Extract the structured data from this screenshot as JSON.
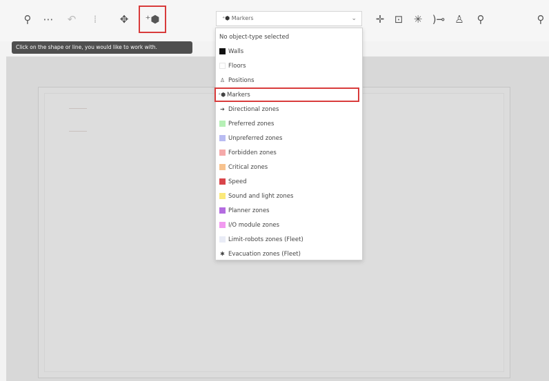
{
  "tooltip": "Click on the shape or line, you would like to work with.",
  "toolbar_left": [
    {
      "name": "search-icon",
      "glyph": "⚲",
      "dim": false
    },
    {
      "name": "ellipsis-icon",
      "glyph": "⋯",
      "dim": false
    },
    {
      "name": "undo-icon",
      "glyph": "↶",
      "dim": true
    },
    {
      "name": "divider-icon",
      "glyph": "⁞",
      "dim": true
    },
    {
      "name": "move-icon",
      "glyph": "✥",
      "dim": false
    },
    {
      "name": "add-marker-icon",
      "glyph": "⁺⬢",
      "dim": false
    }
  ],
  "toolbar_right": [
    {
      "name": "crosshair-icon",
      "glyph": "✛"
    },
    {
      "name": "zoom-fit-icon",
      "glyph": "⊡"
    },
    {
      "name": "sun-icon",
      "glyph": "✳"
    },
    {
      "name": "bracket-icon",
      "glyph": ")⊸"
    },
    {
      "name": "people-icon",
      "glyph": "♙"
    },
    {
      "name": "zoom-in-icon",
      "glyph": "⚲"
    },
    {
      "name": "zoom-out-icon",
      "glyph": "⚲"
    }
  ],
  "select": {
    "icon": "⁺⬢",
    "value": "Markers",
    "chevron": "⌄"
  },
  "options": [
    {
      "label": "No object-type selected",
      "kind": "none"
    },
    {
      "label": "Walls",
      "kind": "swatch",
      "color": "#111111"
    },
    {
      "label": "Floors",
      "kind": "swatch",
      "color": "#ffffff"
    },
    {
      "label": "Positions",
      "kind": "glyph",
      "glyph": "♙"
    },
    {
      "label": "Markers",
      "kind": "glyph",
      "glyph": "⁺⬢",
      "selected": true
    },
    {
      "label": "Directional zones",
      "kind": "glyph",
      "glyph": "➔"
    },
    {
      "label": "Preferred zones",
      "kind": "swatch",
      "color": "#b6f0b6"
    },
    {
      "label": "Unpreferred zones",
      "kind": "swatch",
      "color": "#b9bcf2"
    },
    {
      "label": "Forbidden zones",
      "kind": "swatch",
      "color": "#f5a9a9"
    },
    {
      "label": "Critical zones",
      "kind": "swatch",
      "color": "#f7c28e"
    },
    {
      "label": "Speed",
      "kind": "swatch",
      "color": "#d9454a"
    },
    {
      "label": "Sound and light zones",
      "kind": "swatch",
      "color": "#fbe97a"
    },
    {
      "label": "Planner zones",
      "kind": "swatch",
      "color": "#b46ce0"
    },
    {
      "label": "I/O module zones",
      "kind": "swatch",
      "color": "#f29af0"
    },
    {
      "label": "Limit-robots zones (Fleet)",
      "kind": "swatch",
      "color": "#e9ecf6"
    },
    {
      "label": "Evacuation zones (Fleet)",
      "kind": "glyph",
      "glyph": "✱"
    }
  ],
  "colors": {
    "highlight": "#d83a3a"
  }
}
